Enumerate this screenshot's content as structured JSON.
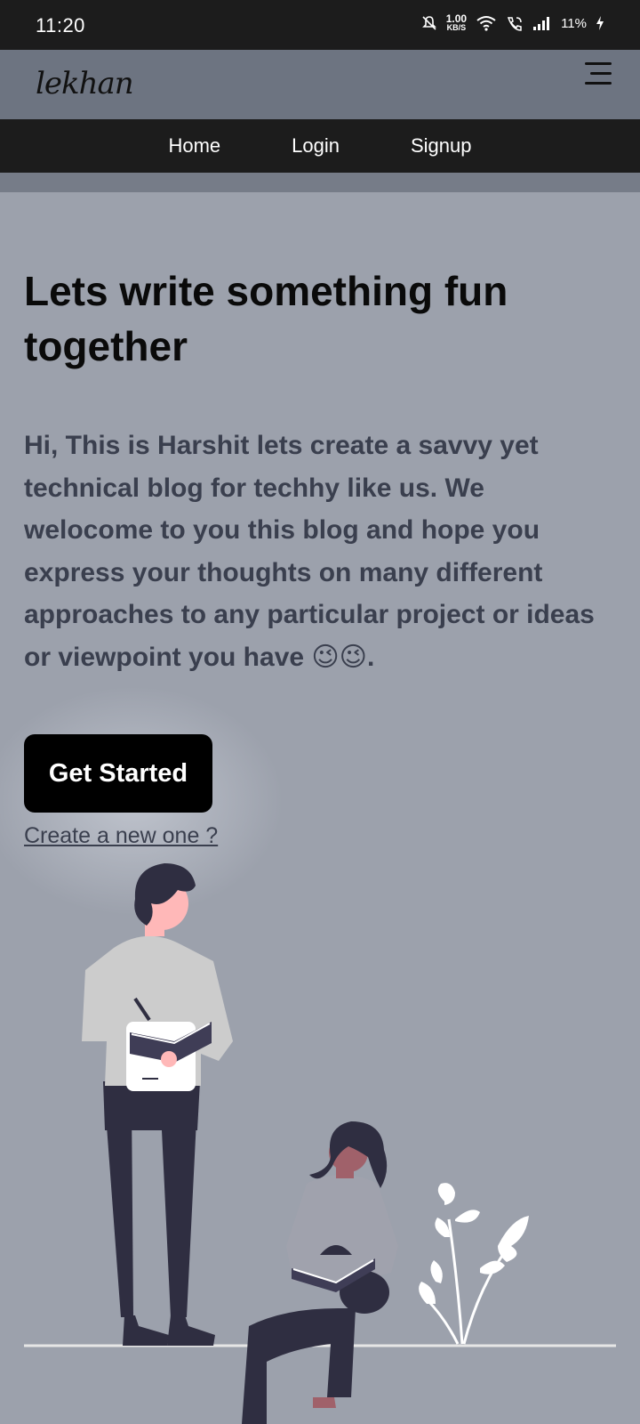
{
  "status_bar": {
    "time": "11:20",
    "net_speed_value": "1.00",
    "net_speed_unit": "KB/S",
    "battery": "11%",
    "icons": [
      "mute-icon",
      "wifi-icon",
      "wifi-call-icon",
      "signal-icon",
      "charging-icon"
    ]
  },
  "app": {
    "logo_text": "lekhan",
    "menu_icon": "hamburger-menu-icon"
  },
  "nav": {
    "items": [
      {
        "label": "Home"
      },
      {
        "label": "Login"
      },
      {
        "label": "Signup"
      }
    ]
  },
  "hero": {
    "title": "Lets write something fun together",
    "text": "Hi, This is Harshit lets create a savvy yet technical blog for techhy like us. We welocome to you this blog and hope you express your thoughts on many different approaches to any particular project or ideas or viewpoint you have 😉😉.",
    "cta_label": "Get Started",
    "secondary_link": "Create a new one ?"
  },
  "colors": {
    "background": "#9ca1ac",
    "status_bar": "#1c1c1c",
    "app_bar": "#6d7481",
    "nav_bar": "#1c1c1c",
    "title": "#0a0a0a",
    "body_text": "#3a3f4e",
    "cta_bg": "#000000"
  }
}
